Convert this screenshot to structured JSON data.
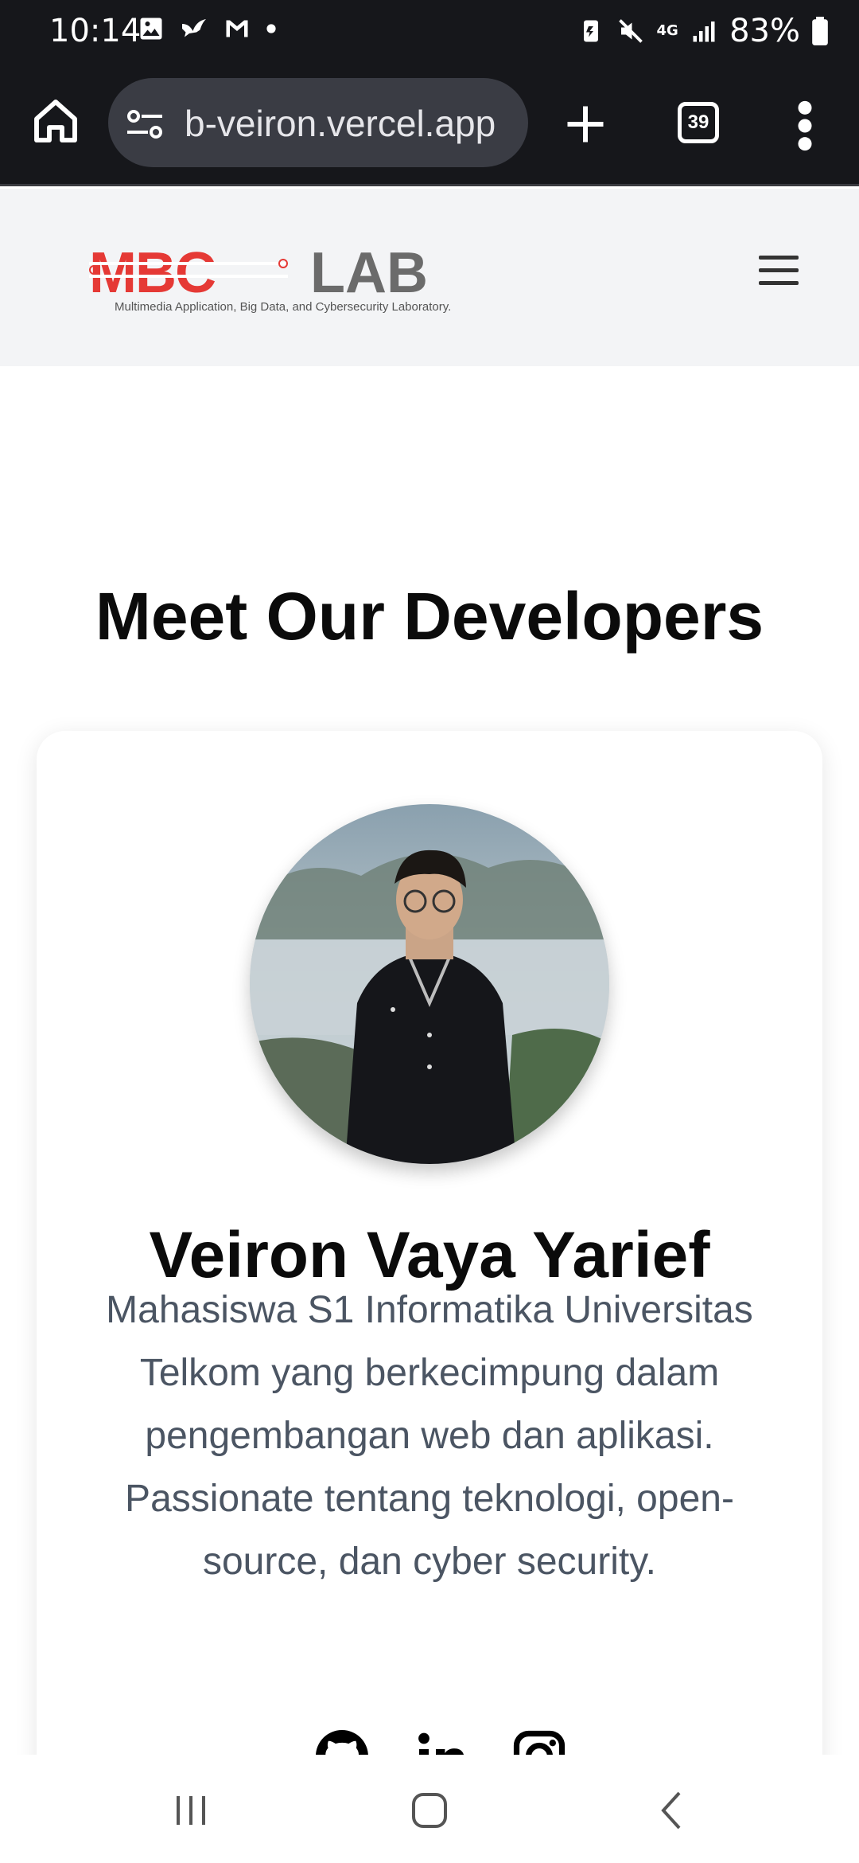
{
  "status_bar": {
    "time": "10:14",
    "battery": "83%",
    "network": "4G"
  },
  "browser": {
    "url": "b-veiron.vercel.app",
    "tab_count": "39"
  },
  "site": {
    "logo_main": "MBC",
    "logo_lab": "LAB",
    "logo_tagline": "Multimedia  Application, Big Data, and Cybersecurity Laboratory."
  },
  "section": {
    "title": "Meet Our Developers"
  },
  "developer": {
    "name": "Veiron Vaya Yarief",
    "bio": "Mahasiswa S1 Informatika Universitas Telkom yang berkecimpung dalam pengembangan web dan aplikasi. Passionate tentang teknologi, open-source, dan cyber security.",
    "socials": [
      "github-icon",
      "linkedin-icon",
      "instagram-icon"
    ]
  },
  "colors": {
    "logo_red": "#e53935",
    "logo_gray": "#6b6b6b",
    "bio_text": "#4b5563",
    "dark_bar": "#16171b"
  }
}
